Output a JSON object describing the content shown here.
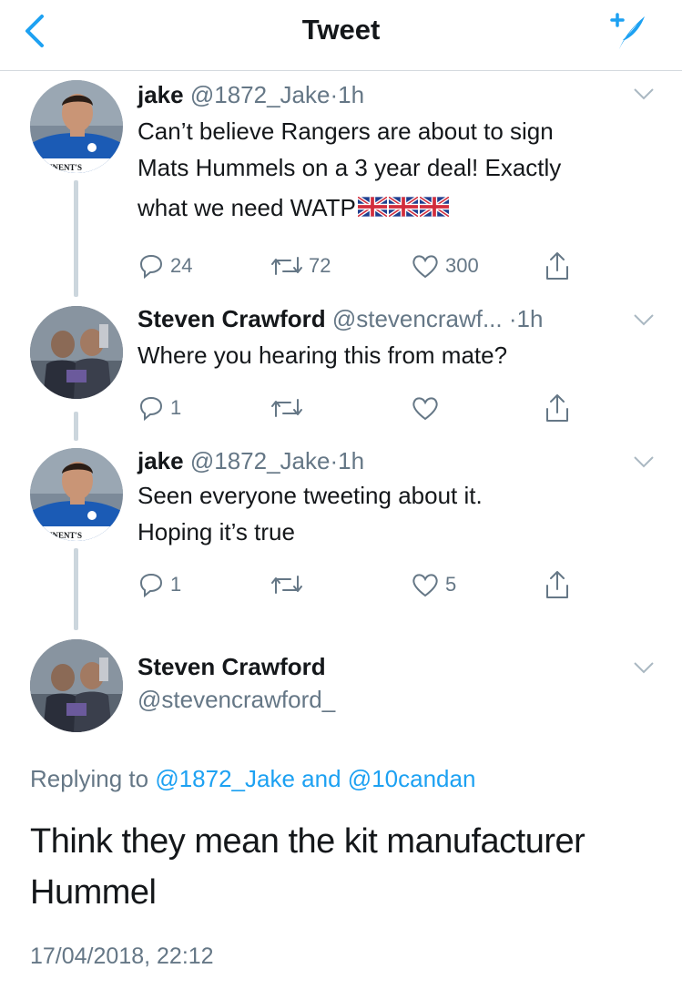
{
  "header": {
    "title": "Tweet"
  },
  "icons": {
    "back": "chevron-left-icon",
    "compose": "compose-tweet-icon",
    "reply": "reply-icon",
    "retweet": "retweet-icon",
    "like": "heart-icon",
    "share": "share-icon",
    "menu": "chevron-down-icon"
  },
  "colors": {
    "accent": "#1da1f2",
    "muted": "#657786",
    "text": "#14171a",
    "divider": "#ccd6dd"
  },
  "tweets": [
    {
      "name": "jake",
      "handle": "@1872_Jake",
      "dot": "·",
      "time": "1h",
      "text_line1": "Can’t believe Rangers are about to sign",
      "text_line2": "Mats Hummels on a 3 year deal! Exactly",
      "text_line3": "what we need WATP",
      "flags": 3,
      "reply_count": "24",
      "retweet_count": "72",
      "like_count": "300"
    },
    {
      "name": "Steven Crawford",
      "handle": "@stevencrawf...",
      "dot": "·",
      "time": "1h",
      "text_line1": "Where you hearing this from mate?",
      "reply_count": "1",
      "retweet_count": "",
      "like_count": ""
    },
    {
      "name": "jake",
      "handle": "@1872_Jake",
      "dot": "·",
      "time": "1h",
      "text_line1": "Seen everyone tweeting about it.",
      "text_line2": "Hoping it’s true",
      "reply_count": "1",
      "retweet_count": "",
      "like_count": "5"
    }
  ],
  "main_tweet": {
    "name": "Steven Crawford",
    "handle": "@stevencrawford_",
    "replying_prefix": "Replying to",
    "replying_mention1": "@1872_Jake",
    "replying_and": "and",
    "replying_mention2": "@10candan",
    "text_line1": "Think they mean the kit manufacturer",
    "text_line2": "Hummel",
    "timestamp": "17/04/2018, 22:12"
  }
}
